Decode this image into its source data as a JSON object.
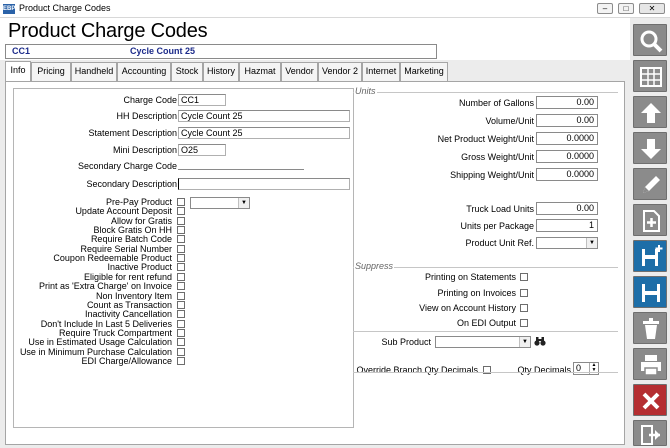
{
  "window": {
    "title": "Product Charge Codes",
    "app_icon_text": "EBP"
  },
  "header": {
    "title": "Product Charge Codes",
    "code": "CC1",
    "description": "Cycle Count 25"
  },
  "tabs": [
    {
      "label": "Info",
      "active": true
    },
    {
      "label": "Pricing"
    },
    {
      "label": "Handheld"
    },
    {
      "label": "Accounting"
    },
    {
      "label": "Stock"
    },
    {
      "label": "History"
    },
    {
      "label": "Hazmat"
    },
    {
      "label": "Vendor"
    },
    {
      "label": "Vendor 2"
    },
    {
      "label": "Internet"
    },
    {
      "label": "Marketing"
    }
  ],
  "info": {
    "charge_code": {
      "label": "Charge Code",
      "value": "CC1"
    },
    "hh_description": {
      "label": "HH Description",
      "value": "Cycle Count 25"
    },
    "statement_description": {
      "label": "Statement Description",
      "value": "Cycle Count 25"
    },
    "mini_description": {
      "label": "Mini Description",
      "value": "O25"
    },
    "secondary_charge_code": {
      "label": "Secondary Charge Code",
      "value": ""
    },
    "secondary_description": {
      "label": "Secondary Description",
      "value": ""
    },
    "checkboxes": [
      {
        "label": "Pre-Pay Product",
        "checked": false
      },
      {
        "label": "Update Account Deposit",
        "checked": false
      },
      {
        "label": "Allow for Gratis",
        "checked": false
      },
      {
        "label": "Block Gratis On HH",
        "checked": false
      },
      {
        "label": "Require Batch Code",
        "checked": false
      },
      {
        "label": "Require Serial Number",
        "checked": false
      },
      {
        "label": "Coupon Redeemable Product",
        "checked": false
      },
      {
        "label": "Inactive Product",
        "checked": false
      },
      {
        "label": "Eligible for rent refund",
        "checked": false
      },
      {
        "label": "Print as 'Extra Charge' on Invoice",
        "checked": false
      },
      {
        "label": "Non Inventory Item",
        "checked": false
      },
      {
        "label": "Count as Transaction",
        "checked": false
      },
      {
        "label": "Inactivity Cancellation",
        "checked": false
      },
      {
        "label": "Don't Include In Last 5 Deliveries",
        "checked": false
      },
      {
        "label": "Require Truck Compartment",
        "checked": false
      },
      {
        "label": "Use in Estimated Usage Calculation",
        "checked": false
      },
      {
        "label": "Use in Minimum Purchase Calculation",
        "checked": false
      },
      {
        "label": "EDI Charge/Allowance",
        "checked": false
      }
    ]
  },
  "units": {
    "header": "Units",
    "number_of_gallons": {
      "label": "Number of Gallons",
      "value": "0.00"
    },
    "volume_unit": {
      "label": "Volume/Unit",
      "value": "0.00"
    },
    "net_weight": {
      "label": "Net Product Weight/Unit",
      "value": "0.0000"
    },
    "gross_weight": {
      "label": "Gross Weight/Unit",
      "value": "0.0000"
    },
    "shipping_weight": {
      "label": "Shipping Weight/Unit",
      "value": "0.0000"
    },
    "truck_load_units": {
      "label": "Truck Load Units",
      "value": "0.00"
    },
    "units_per_package": {
      "label": "Units per Package",
      "value": "1"
    },
    "product_unit_ref": {
      "label": "Product Unit Ref.",
      "value": ""
    }
  },
  "suppress": {
    "header": "Suppress",
    "items": [
      {
        "label": "Printing on Statements",
        "checked": false
      },
      {
        "label": "Printing on Invoices",
        "checked": false
      },
      {
        "label": "View on Account History",
        "checked": false
      },
      {
        "label": "On EDI Output",
        "checked": false
      }
    ]
  },
  "sub_product": {
    "label": "Sub Product",
    "value": ""
  },
  "override_branch": {
    "label": "Override Branch Qty Decimals",
    "checked": false
  },
  "qty_decimals": {
    "label": "Qty Decimals",
    "value": "0"
  },
  "sidebar": [
    "search-icon",
    "grid-icon",
    "arrow-up-icon",
    "arrow-down-icon",
    "pencil-icon",
    "new-document-icon",
    "save-new-icon",
    "save-icon",
    "delete-icon",
    "print-icon",
    "cancel-icon",
    "exit-icon"
  ]
}
